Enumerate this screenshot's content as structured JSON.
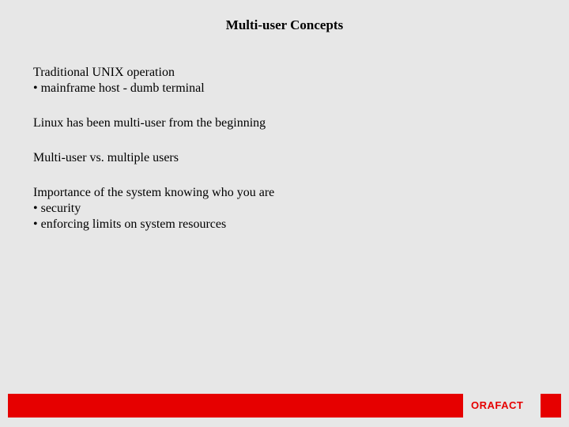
{
  "title": "Multi-user Concepts",
  "body": {
    "block1": {
      "line1": "Traditional UNIX operation",
      "bullet1": "• mainframe host - dumb terminal"
    },
    "block2": {
      "line1": "Linux has been multi-user from the beginning"
    },
    "block3": {
      "line1": "Multi-user vs. multiple users"
    },
    "block4": {
      "line1": "Importance of the system knowing who you are",
      "bullet1": "• security",
      "bullet2": "• enforcing limits on system resources"
    }
  },
  "footer": {
    "brand": "ORAFACT"
  }
}
